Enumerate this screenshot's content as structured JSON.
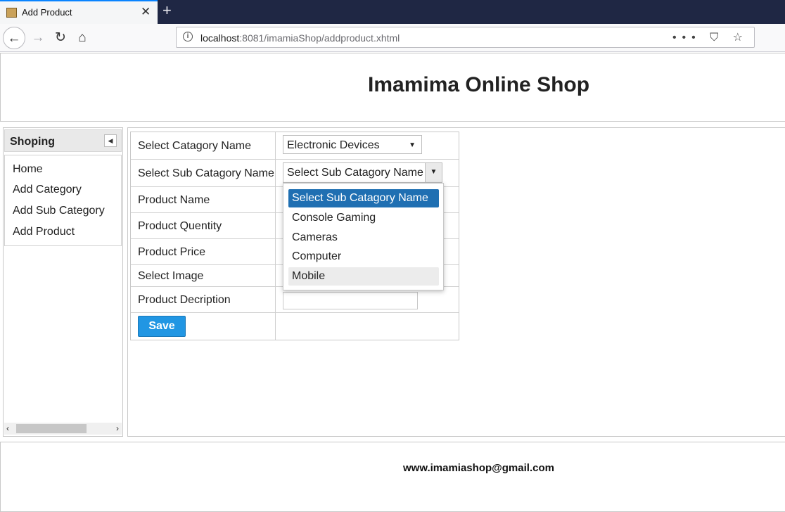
{
  "browser": {
    "tab_title": "Add Product",
    "tab_close": "✕",
    "new_tab": "+",
    "url_host": "localhost",
    "url_rest": ":8081/imamiaShop/addproduct.xhtml",
    "url_actions": "••• ⛉ ☆"
  },
  "header": {
    "title": "Imamima Online Shop"
  },
  "sidebar": {
    "title": "Shoping",
    "items": [
      {
        "label": "Home"
      },
      {
        "label": "Add Category"
      },
      {
        "label": "Add Sub Category"
      },
      {
        "label": "Add Product"
      }
    ]
  },
  "form": {
    "labels": {
      "category": "Select Catagory Name",
      "subcategory": "Select Sub Catagory Name",
      "product_name": "Product Name",
      "quantity": "Product Quentity",
      "price": "Product Price",
      "image": "Select Image",
      "description": "Product Decription"
    },
    "category_value": "Electronic Devices",
    "subcategory_value": "Select Sub Catagory Name",
    "save_label": "Save"
  },
  "dropdown": {
    "options": [
      {
        "label": "Select Sub Catagory Name",
        "state": "selected"
      },
      {
        "label": "Console Gaming",
        "state": ""
      },
      {
        "label": "Cameras",
        "state": ""
      },
      {
        "label": "Computer",
        "state": ""
      },
      {
        "label": "Mobile",
        "state": "hover"
      }
    ]
  },
  "footer": {
    "text": "www.imamiashop@gmail.com"
  },
  "colors": {
    "accent": "#2196e3",
    "selected_option": "#1f6fb2",
    "tabbar": "#1f2744"
  }
}
